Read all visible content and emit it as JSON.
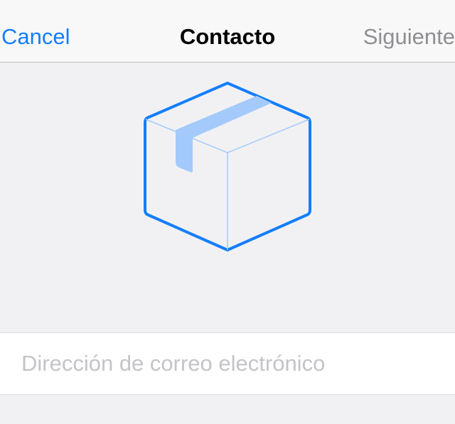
{
  "navbar": {
    "cancel_label": "Cancel",
    "title": "Contacto",
    "next_label": "Siguiente"
  },
  "hero": {
    "icon": "package-box-icon",
    "stroke_color": "#147efb",
    "tape_color": "#a3cafb"
  },
  "form": {
    "email_placeholder": "Dirección de correo electrónico",
    "email_value": ""
  },
  "colors": {
    "accent": "#147efb",
    "disabled": "#8e8e93",
    "background": "#f1f1f4"
  }
}
